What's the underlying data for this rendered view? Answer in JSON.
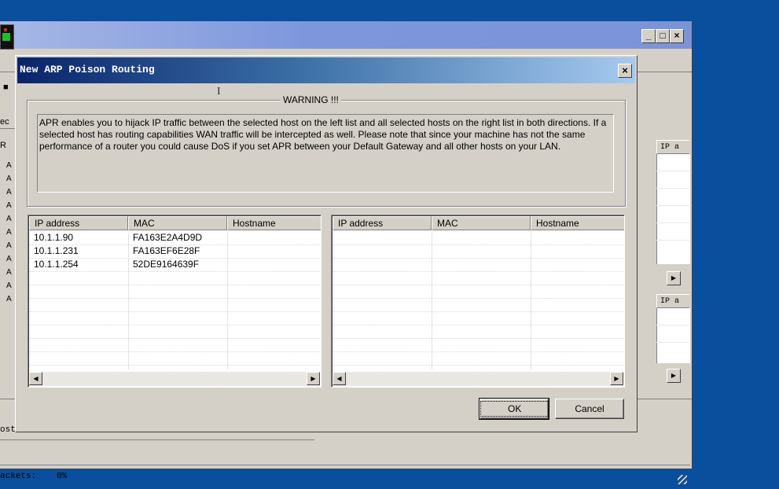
{
  "background_window": {
    "status_text": "ackets:",
    "status_value": "0%",
    "fragment_rec": "ec",
    "fragment_r": "R",
    "fragment_ost": "ost",
    "right_column_header": "IP a",
    "left_items": [
      "A",
      "A",
      "A",
      "A",
      "A",
      "A",
      "A",
      "A",
      "A",
      "A",
      "A"
    ]
  },
  "dialog": {
    "title": "New ARP Poison Routing",
    "close_label": "×",
    "warning_legend": "WARNING !!!",
    "warning_text": "APR enables you to hijack IP traffic between the selected host on the left list and all selected hosts on the right list in both directions. If a selected host has routing capabilities WAN traffic will be intercepted as well. Please note that since your machine has not the same performance of a router you could cause DoS if you set APR between your Default Gateway and all other hosts on your LAN.",
    "left_list": {
      "columns": [
        "IP address",
        "MAC",
        "Hostname"
      ],
      "rows": [
        [
          "10.1.1.90",
          "FA163E2A4D9D",
          ""
        ],
        [
          "10.1.1.231",
          "FA163EF6E28F",
          ""
        ],
        [
          "10.1.1.254",
          "52DE9164639F",
          ""
        ]
      ]
    },
    "right_list": {
      "columns": [
        "IP address",
        "MAC",
        "Hostname"
      ],
      "rows": []
    },
    "ok_label": "OK",
    "cancel_label": "Cancel"
  },
  "colors": {
    "desktop": "#0a4f9e",
    "dialog_face": "#d4d0c8",
    "title_start": "#0a246a",
    "title_end": "#a6caf0"
  }
}
